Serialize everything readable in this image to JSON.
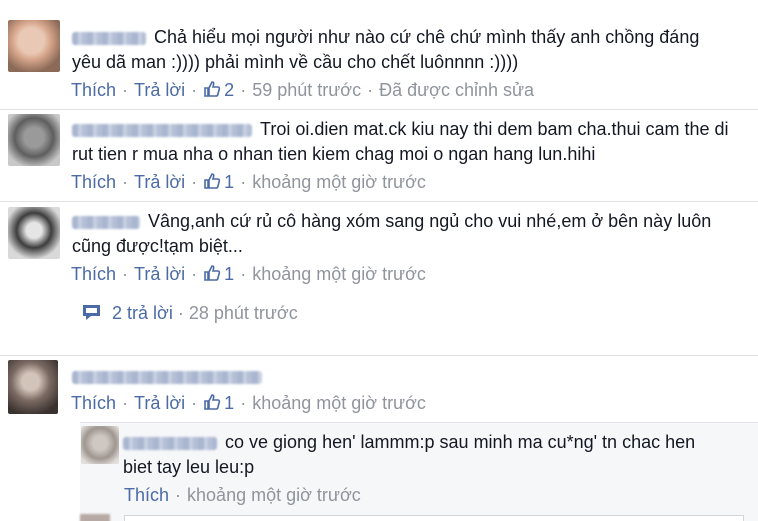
{
  "comments": [
    {
      "text": "Chả hiểu mọi người như nào cứ chê chứ mình thấy anh chồng đáng yêu dã man :)))) phải mình về cầu cho chết luônnnn :))))",
      "like": "Thích",
      "reply": "Trả lời",
      "likes": "2",
      "time": "59 phút trước",
      "edited": "Đã được chỉnh sửa"
    },
    {
      "text": "Troi oi.dien mat.ck kiu nay thi dem bam cha.thui cam the di rut tien r mua nha o nhan tien kiem chag moi o ngan hang lun.hihi",
      "like": "Thích",
      "reply": "Trả lời",
      "likes": "1",
      "time": "khoảng một giờ trước"
    },
    {
      "text": "Vâng,anh cứ rủ cô hàng xóm sang ngủ cho vui nhé,em ở bên này luôn cũng được!tạm biệt...",
      "like": "Thích",
      "reply": "Trả lời",
      "likes": "1",
      "time": "khoảng một giờ trước",
      "replies_link": "2 trả lời",
      "replies_time": "28 phút trước"
    },
    {
      "text": "",
      "like": "Thích",
      "reply": "Trả lời",
      "likes": "1",
      "time": "khoảng một giờ trước"
    }
  ],
  "nested_reply": {
    "text": "co ve giong hen' lammm:p sau minh ma cu*ng' tn chac hen biet tay leu leu:p",
    "like": "Thích",
    "time": "khoảng một giờ trước"
  },
  "colors": {
    "link": "#4b6aa6",
    "meta": "#90949c",
    "text": "#141823"
  },
  "icons": {
    "like": "thumbs-up-icon",
    "reply": "speech-bubble-icon"
  }
}
